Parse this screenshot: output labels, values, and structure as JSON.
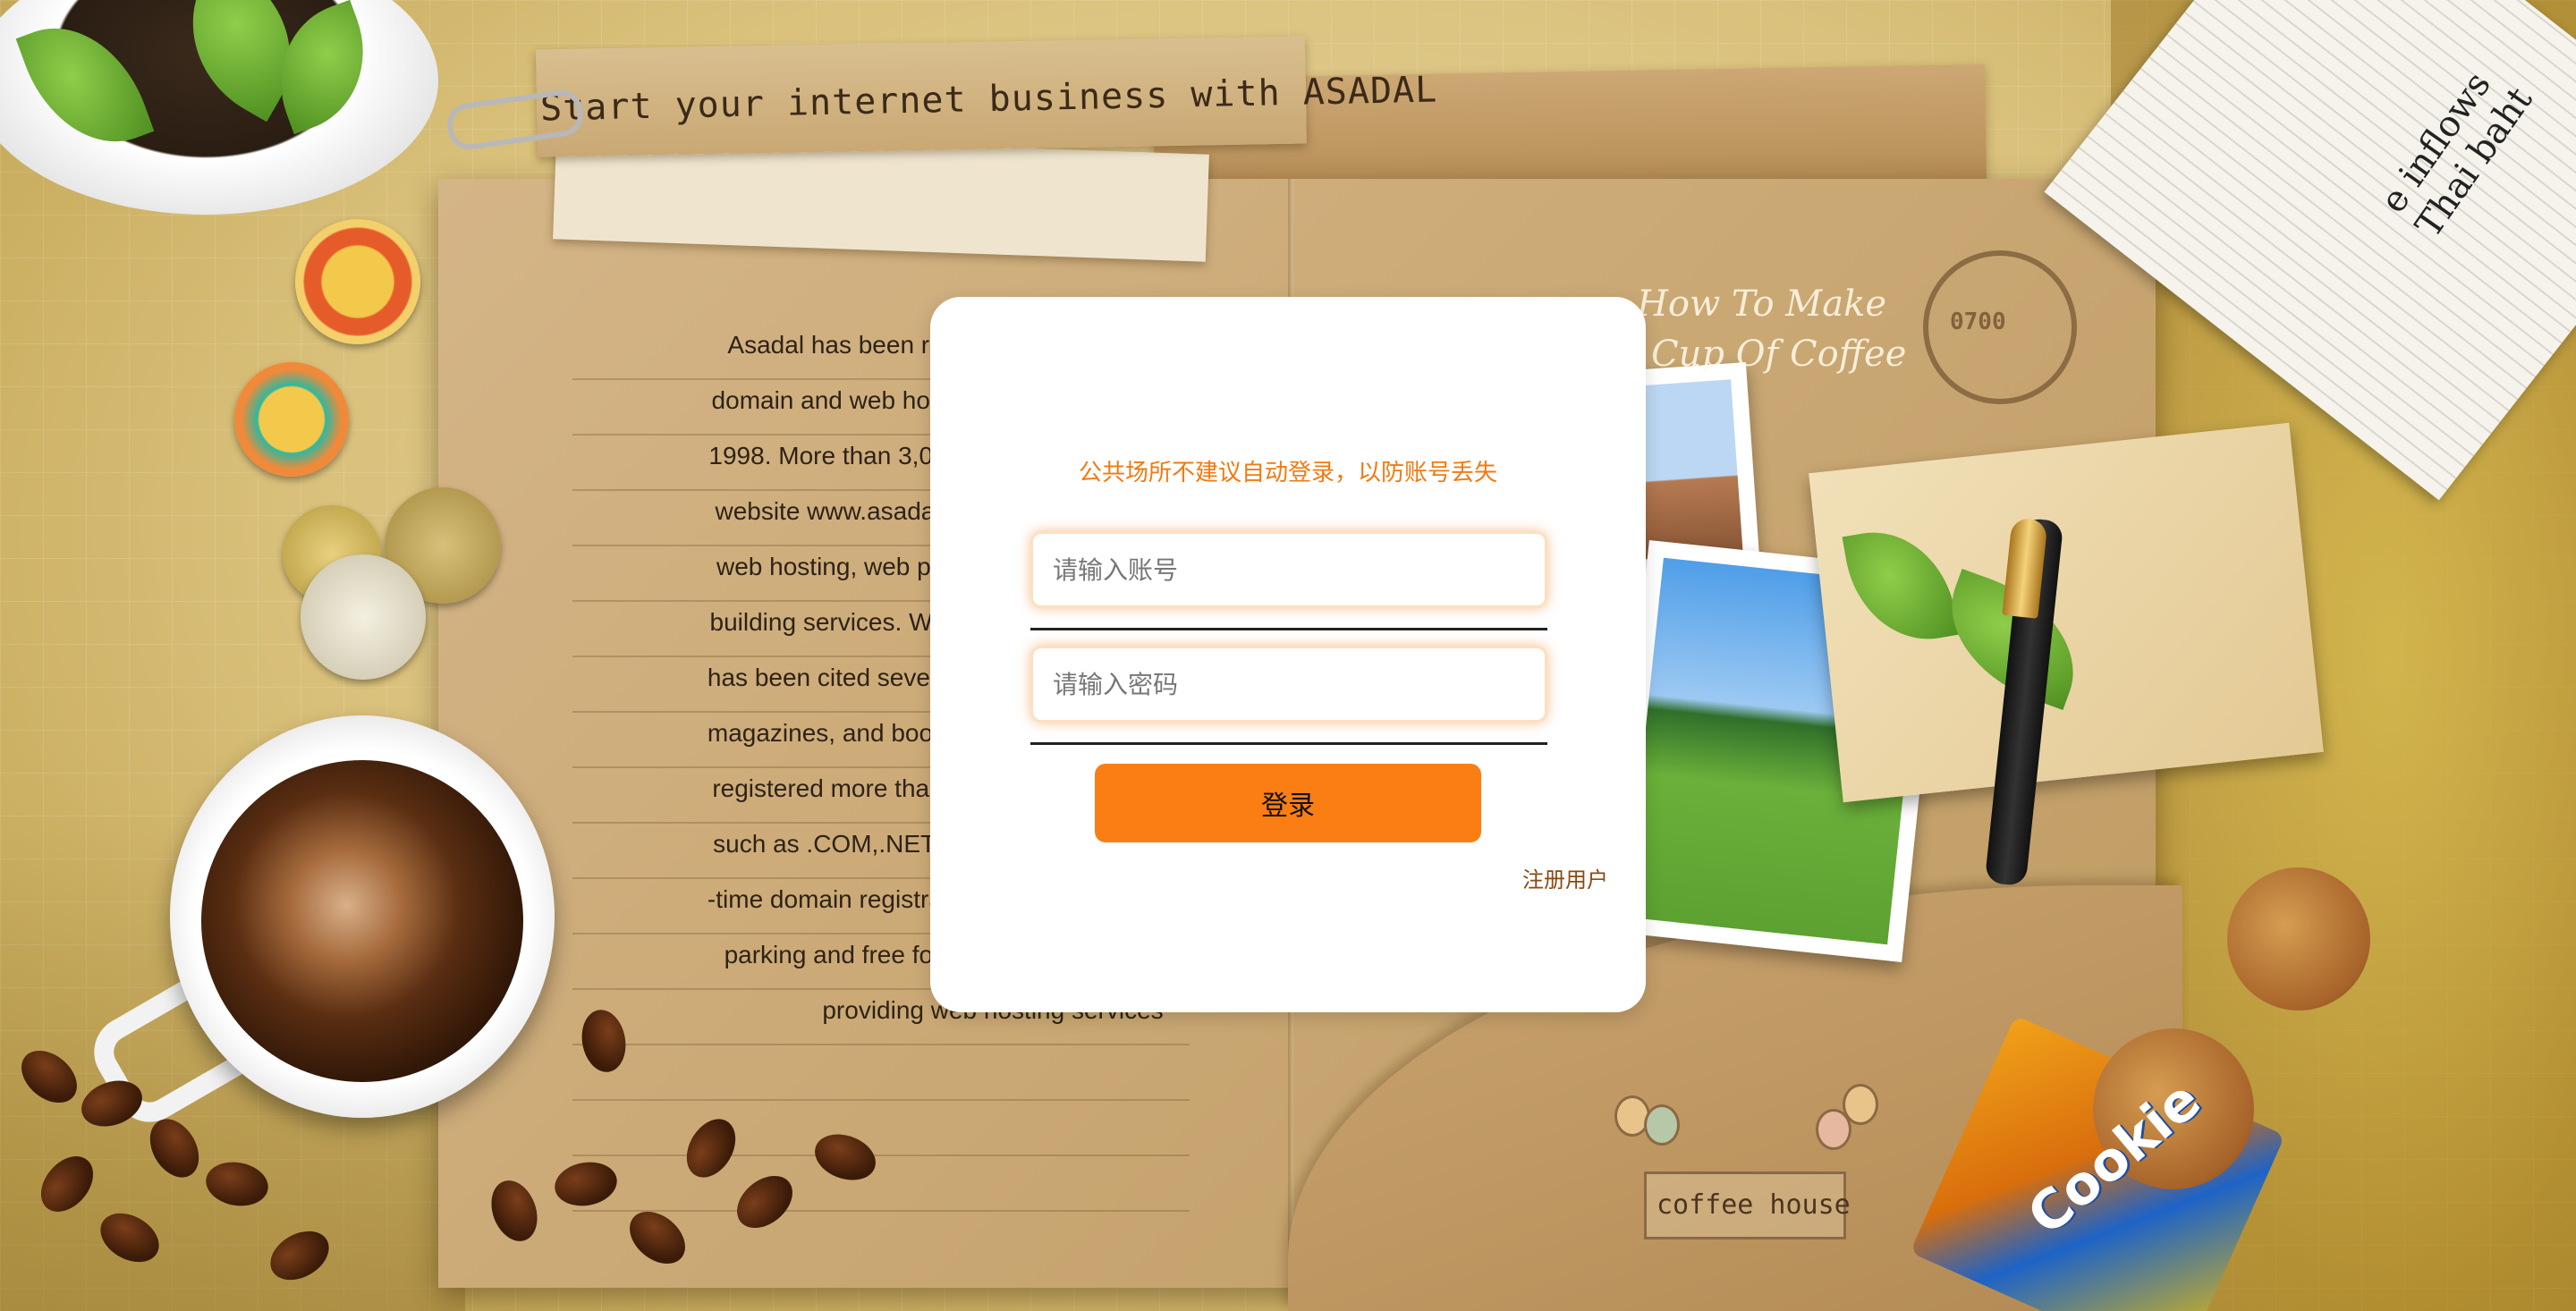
{
  "banner": {
    "title": "Start your internet business with ASADAL"
  },
  "notebook": {
    "paragraph_lines": [
      "Asadal has been running o",
      "domain and web hosting sites",
      "1998. More than 3,000,000 pe",
      "website www.asadal.com, for",
      "web hosting, web programmi",
      "building services. We are very",
      "has been cited several times b",
      "magazines, and books all over",
      "registered more than 100,000",
      "such as .COM,.NET, and .OR",
      "-time domain registrations, ren",
      "parking and free forwarding",
      "providing web hosting services"
    ],
    "howto_lines": [
      "How To Make",
      "Cup Of Coffee"
    ],
    "stamp_text": "0700",
    "sign_text": "coffee house"
  },
  "decor": {
    "cookie_pack_text": "Cookie",
    "newspaper_lines": [
      "e inflows",
      "Thai baht"
    ]
  },
  "login": {
    "notice": "公共场所不建议自动登录，以防账号丢失",
    "account_placeholder": "请输入账号",
    "password_placeholder": "请输入密码",
    "login_button": "登录",
    "register_link": "注册用户"
  },
  "colors": {
    "accent": "#fa7e14",
    "notice": "#f17a10",
    "register": "#8a4a10"
  }
}
